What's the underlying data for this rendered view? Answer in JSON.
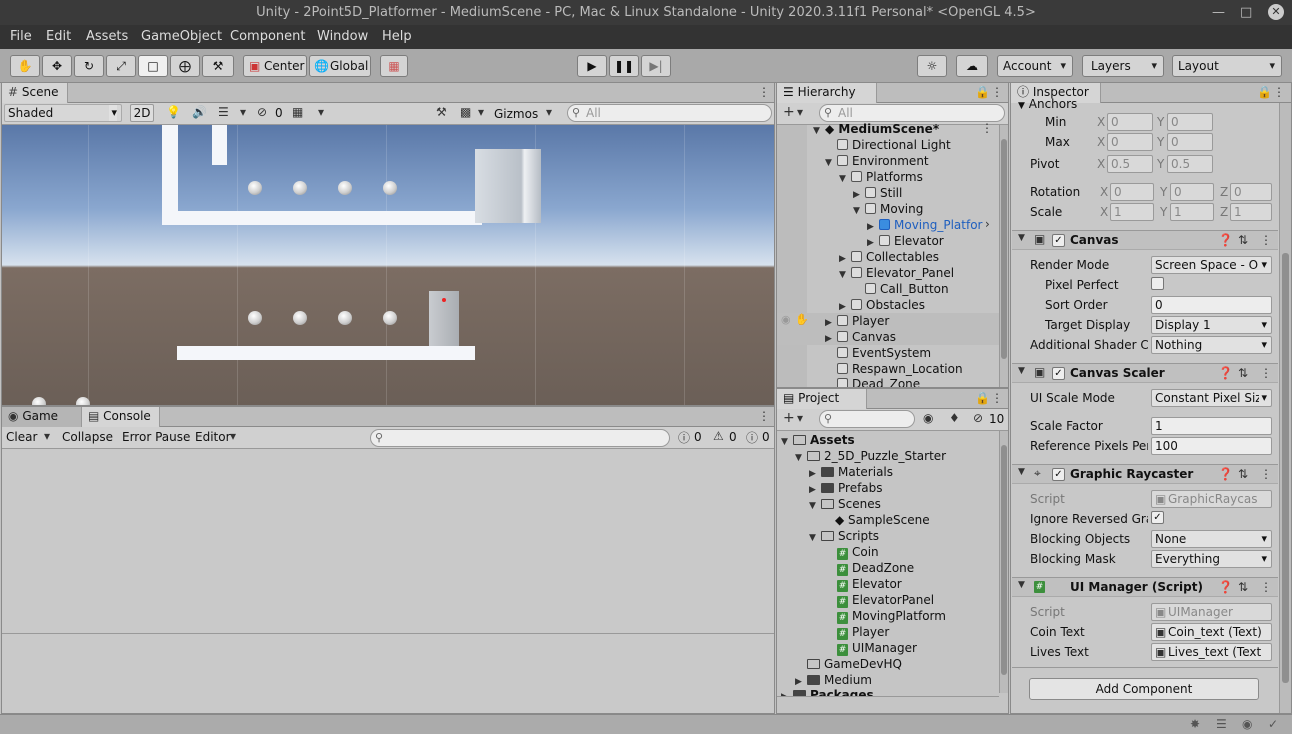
{
  "window": {
    "title": "Unity - 2Point5D_Platformer - MediumScene - PC, Mac & Linux Standalone - Unity 2020.3.11f1 Personal* <OpenGL 4.5>"
  },
  "menu": [
    "File",
    "Edit",
    "Assets",
    "GameObject",
    "Component",
    "Window",
    "Help"
  ],
  "toolbar": {
    "center": "Center",
    "global": "Global",
    "account": "Account",
    "layers": "Layers",
    "layout": "Layout"
  },
  "scene": {
    "tab": "Scene",
    "shading": "Shaded",
    "mode2d": "2D",
    "hidden_count": "0",
    "gizmos": "Gizmos",
    "search_placeholder": "All"
  },
  "bottom": {
    "tab_game": "Game",
    "tab_console": "Console",
    "clear": "Clear",
    "collapse": "Collapse",
    "error_pause": "Error Pause",
    "editor": "Editor",
    "errors": "0",
    "warnings": "0",
    "logs": "0"
  },
  "hierarchy": {
    "tab": "Hierarchy",
    "search_placeholder": "All",
    "scene": "MediumScene*",
    "items": [
      {
        "label": "Directional Light"
      },
      {
        "label": "Environment"
      },
      {
        "label": "Platforms"
      },
      {
        "label": "Still"
      },
      {
        "label": "Moving"
      },
      {
        "label": "Moving_Platfor"
      },
      {
        "label": "Elevator"
      },
      {
        "label": "Collectables"
      },
      {
        "label": "Elevator_Panel"
      },
      {
        "label": "Call_Button"
      },
      {
        "label": "Obstacles"
      },
      {
        "label": "Player"
      },
      {
        "label": "Canvas"
      },
      {
        "label": "EventSystem"
      },
      {
        "label": "Respawn_Location"
      },
      {
        "label": "Dead_Zone"
      }
    ]
  },
  "project": {
    "tab": "Project",
    "hidden_count": "10",
    "items": [
      {
        "label": "Assets"
      },
      {
        "label": "2_5D_Puzzle_Starter"
      },
      {
        "label": "Materials"
      },
      {
        "label": "Prefabs"
      },
      {
        "label": "Scenes"
      },
      {
        "label": "SampleScene"
      },
      {
        "label": "Scripts"
      },
      {
        "label": "Coin"
      },
      {
        "label": "DeadZone"
      },
      {
        "label": "Elevator"
      },
      {
        "label": "ElevatorPanel"
      },
      {
        "label": "MovingPlatform"
      },
      {
        "label": "Player"
      },
      {
        "label": "UIManager"
      },
      {
        "label": "GameDevHQ"
      },
      {
        "label": "Medium"
      },
      {
        "label": "Packages"
      }
    ]
  },
  "inspector": {
    "tab": "Inspector",
    "anchors": "Anchors",
    "min": "Min",
    "max": "Max",
    "min_x": "0",
    "min_y": "0",
    "max_x": "0",
    "max_y": "0",
    "pivot": "Pivot",
    "pivot_x": "0.5",
    "pivot_y": "0.5",
    "rotation": "Rotation",
    "rot_x": "0",
    "rot_y": "0",
    "rot_z": "0",
    "scale": "Scale",
    "scale_x": "1",
    "scale_y": "1",
    "scale_z": "1",
    "axis_x": "X",
    "axis_y": "Y",
    "axis_z": "Z",
    "canvas": {
      "title": "Canvas",
      "render_mode_label": "Render Mode",
      "render_mode": "Screen Space - O",
      "pixel_perfect_label": "Pixel Perfect",
      "sort_order_label": "Sort Order",
      "sort_order": "0",
      "target_display_label": "Target Display",
      "target_display": "Display 1",
      "shader_label": "Additional Shader Ch",
      "shader": "Nothing"
    },
    "scaler": {
      "title": "Canvas Scaler",
      "mode_label": "UI Scale Mode",
      "mode": "Constant Pixel Siz",
      "factor_label": "Scale Factor",
      "factor": "1",
      "ref_label": "Reference Pixels Per",
      "ref": "100"
    },
    "raycaster": {
      "title": "Graphic Raycaster",
      "script_label": "Script",
      "script": "GraphicRaycas",
      "ignore_label": "Ignore Reversed Grap",
      "blocking_label": "Blocking Objects",
      "blocking": "None",
      "mask_label": "Blocking Mask",
      "mask": "Everything"
    },
    "ui_manager": {
      "title": "UI Manager (Script)",
      "script_label": "Script",
      "script": "UIManager",
      "coin_label": "Coin Text",
      "coin": "Coin_text (Text)",
      "lives_label": "Lives Text",
      "lives": "Lives_text (Text"
    },
    "add_component": "Add Component"
  }
}
